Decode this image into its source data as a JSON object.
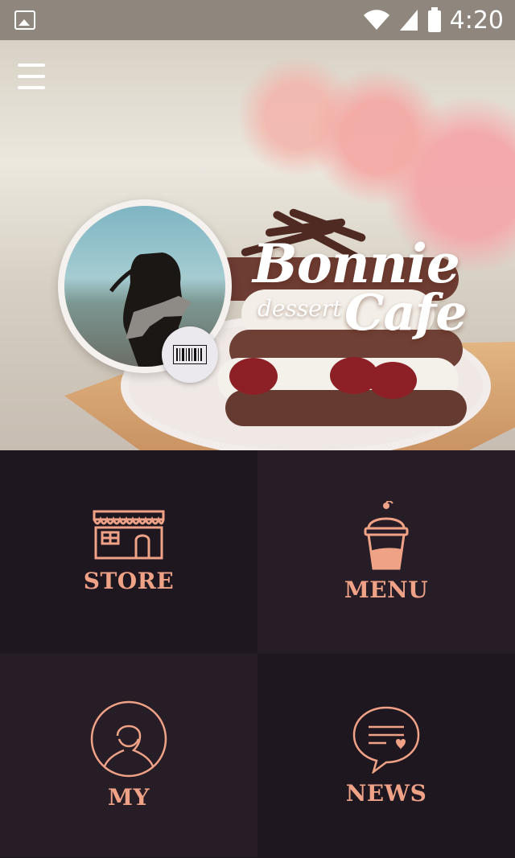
{
  "status_bar": {
    "time": "4:20",
    "icons": [
      "image-icon",
      "wifi-icon",
      "signal-icon",
      "battery-icon"
    ]
  },
  "header": {
    "menu_icon": "hamburger-menu-icon",
    "brand": {
      "line1": "Bonnie",
      "line2": "dessert",
      "line3": "Cafe"
    }
  },
  "profile": {
    "avatar_icon": "profile-photo",
    "barcode_icon": "barcode-icon"
  },
  "tiles": [
    {
      "label": "STORE",
      "icon": "store-icon"
    },
    {
      "label": "MENU",
      "icon": "cup-icon"
    },
    {
      "label": "MY",
      "icon": "user-icon"
    },
    {
      "label": "NEWS",
      "icon": "message-heart-icon"
    }
  ],
  "colors": {
    "status_bar": "#8f877d",
    "tile_dark": "#1e1720",
    "tile_light": "#271d26",
    "accent": "#f0a287"
  }
}
